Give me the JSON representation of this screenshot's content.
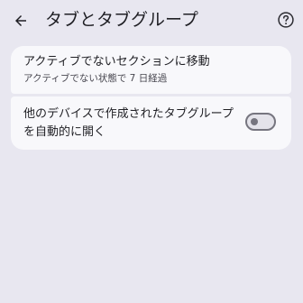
{
  "header": {
    "title": "タブとタブグループ",
    "back_icon": "arrow-left-icon",
    "help_icon": "help-circle-icon"
  },
  "settings": {
    "inactive": {
      "title": "アクティブでないセクションに移動",
      "subtitle": "アクティブでない状態で 7 日経過"
    },
    "auto_open": {
      "label": "他のデバイスで作成されたタブグループを自動的に開く",
      "enabled": false
    }
  },
  "colors": {
    "background": "#e8e7f0",
    "card": "#f8f8fb",
    "text": "#1f1f24",
    "secondary_text": "#47464f",
    "toggle_outline": "#76757f"
  }
}
